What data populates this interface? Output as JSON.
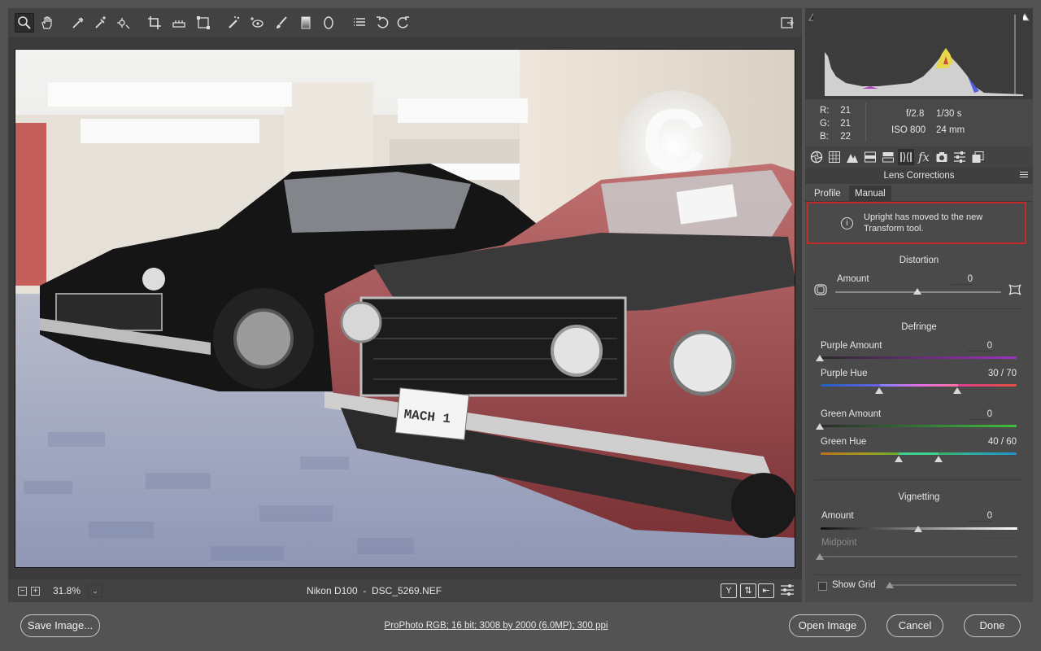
{
  "toolbar": {
    "tools": [
      "zoom-icon",
      "hand-icon",
      "white-balance-icon",
      "color-sampler-icon",
      "targeted-adjustment-icon",
      "crop-icon",
      "straighten-icon",
      "transform-icon",
      "spot-removal-icon",
      "red-eye-icon",
      "adjustment-brush-icon",
      "graduated-filter-icon",
      "radial-filter-icon",
      "preset-list-icon",
      "rotate-left-icon",
      "rotate-right-icon"
    ],
    "fullscreen_icon": "toggle-fullscreen-icon"
  },
  "status": {
    "zoom": "31.8%",
    "zoom_dropdown": "⌄",
    "camera": "Nikon D100",
    "separator": "-",
    "filename": "DSC_5269.NEF",
    "y_label": "Y"
  },
  "histogram": {
    "r_label": "R:",
    "r_value": "21",
    "g_label": "G:",
    "g_value": "21",
    "b_label": "B:",
    "b_value": "22",
    "aperture": "f/2.8",
    "shutter": "1/30 s",
    "iso": "ISO 800",
    "focal": "24 mm"
  },
  "panel": {
    "title": "Lens Corrections",
    "tabs": [
      "Profile",
      "Manual"
    ],
    "active_tab": "Manual",
    "notice": "Upright has moved to the new Transform tool.",
    "distortion": {
      "title": "Distortion",
      "amount_label": "Amount",
      "amount_value": "0"
    },
    "defringe": {
      "title": "Defringe",
      "purple_amount_label": "Purple Amount",
      "purple_amount_value": "0",
      "purple_hue_label": "Purple Hue",
      "purple_hue_value": "30 / 70",
      "green_amount_label": "Green Amount",
      "green_amount_value": "0",
      "green_hue_label": "Green Hue",
      "green_hue_value": "40 / 60"
    },
    "vignetting": {
      "title": "Vignetting",
      "amount_label": "Amount",
      "amount_value": "0",
      "midpoint_label": "Midpoint",
      "midpoint_value": ""
    },
    "show_grid_label": "Show Grid"
  },
  "footer": {
    "save_label": "Save Image...",
    "workflow_link": "ProPhoto RGB; 16 bit; 3008 by 2000 (6.0MP); 300 ppi",
    "open_label": "Open Image",
    "cancel_label": "Cancel",
    "done_label": "Done"
  },
  "photo": {
    "plate_text": "MACH 1",
    "sign_letter": "C"
  }
}
